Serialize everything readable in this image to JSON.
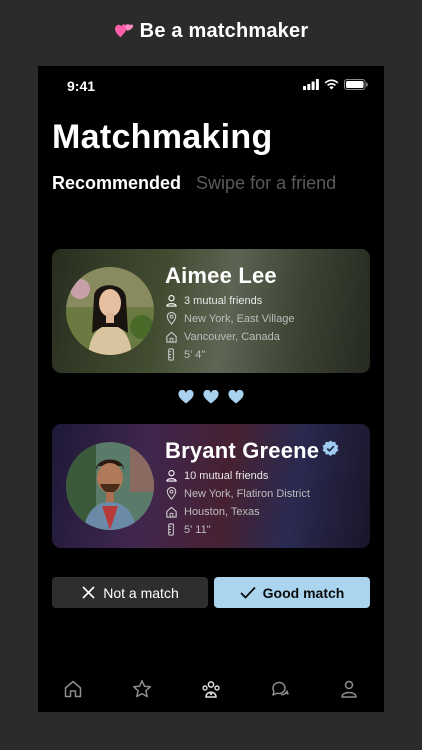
{
  "banner": {
    "text": "Be a matchmaker",
    "emoji_icon": "two-hearts-icon"
  },
  "status_bar": {
    "time": "9:41"
  },
  "page": {
    "title": "Matchmaking"
  },
  "tabs": [
    {
      "label": "Recommended",
      "active": true
    },
    {
      "label": "Swipe for a friend",
      "active": false
    }
  ],
  "profiles": [
    {
      "name": "Aimee Lee",
      "verified": false,
      "mutual_friends": "3 mutual friends",
      "location": "New York, East Village",
      "hometown": "Vancouver, Canada",
      "height": "5' 4\""
    },
    {
      "name": "Bryant Greene",
      "verified": true,
      "mutual_friends": "10 mutual friends",
      "location": "New York, Flatiron District",
      "hometown": "Houston, Texas",
      "height": "5' 11\""
    }
  ],
  "actions": {
    "not_match": "Not a match",
    "good_match": "Good match"
  },
  "nav": [
    "home-icon",
    "star-icon",
    "matchmaker-icon",
    "chat-icon",
    "profile-icon"
  ],
  "colors": {
    "accent": "#abd4ef",
    "heart": "#a9d2f0",
    "background": "#000000",
    "frame": "#2b2b2b"
  }
}
